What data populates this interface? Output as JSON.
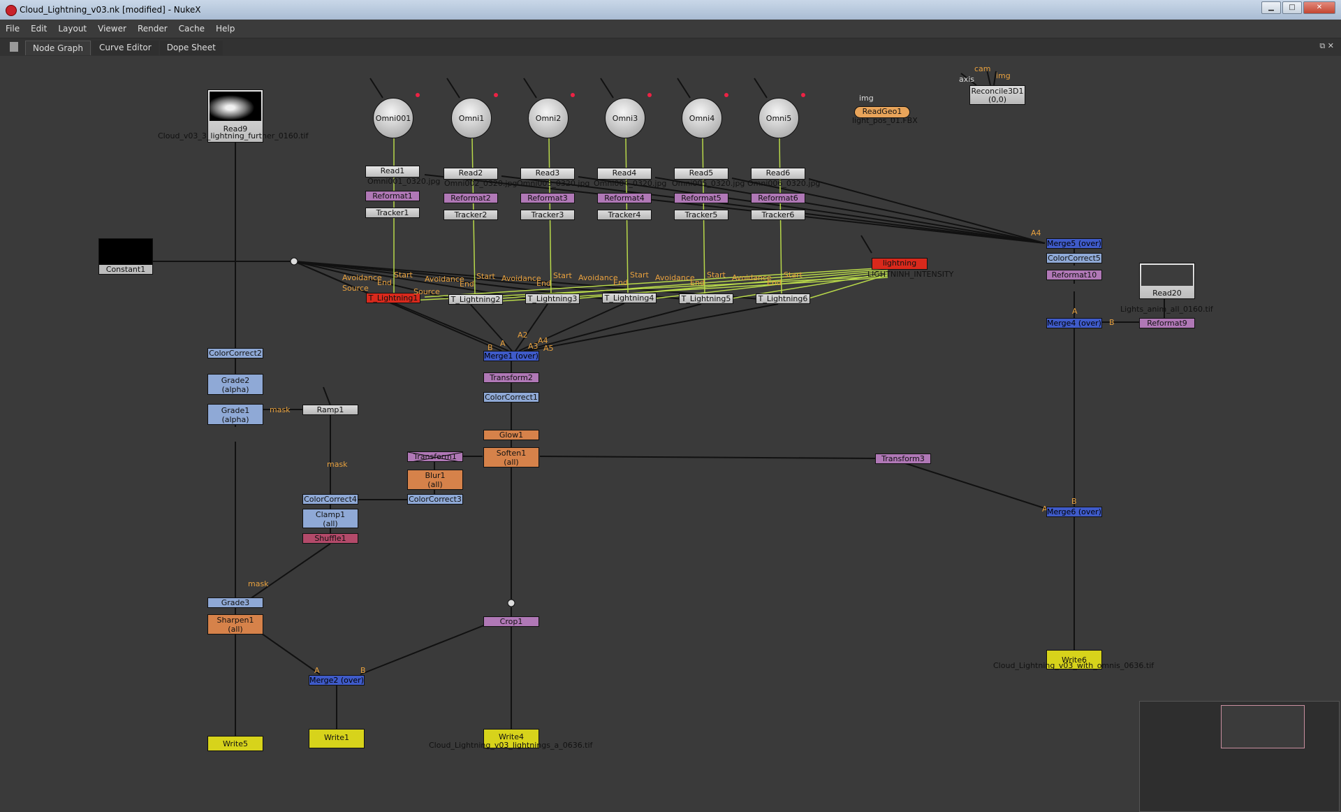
{
  "window": {
    "title": "Cloud_Lightning_v03.nk [modified] - NukeX"
  },
  "menu": [
    "File",
    "Edit",
    "Layout",
    "Viewer",
    "Render",
    "Cache",
    "Help"
  ],
  "tabs": [
    "Node Graph",
    "Curve Editor",
    "Dope Sheet"
  ],
  "colors": {
    "read": "#d0d0d0",
    "reformat": "#b078b6",
    "lightning_red": "#d9291c",
    "merge_blue": "#3f5bc9",
    "color_lblue": "#8fa9d6",
    "filter_orange": "#d6824a",
    "write_yellow": "#d7d31b",
    "wire_green": "#b8d84a",
    "pin_orange": "#e8a13e"
  },
  "nodes": {
    "read9": {
      "name": "Read9",
      "file": "Cloud_v03_3_lightning_further_0160.tif"
    },
    "constant1": {
      "name": "Constant1"
    },
    "omnis": [
      "Omni001",
      "Omni1",
      "Omni2",
      "Omni3",
      "Omni4",
      "Omni5"
    ],
    "reads": [
      {
        "name": "Read1",
        "file": "Omni001_0320.jpg"
      },
      {
        "name": "Read2",
        "file": "Omni002_0320.jpg"
      },
      {
        "name": "Read3",
        "file": "Omni003_0320.jpg"
      },
      {
        "name": "Read4",
        "file": "Omni004_0320.jpg"
      },
      {
        "name": "Read5",
        "file": "Omni005_0320.jpg"
      },
      {
        "name": "Read6",
        "file": "Omni006_0320.jpg"
      }
    ],
    "reformats": [
      "Reformat1",
      "Reformat2",
      "Reformat3",
      "Reformat4",
      "Reformat5",
      "Reformat6"
    ],
    "trackers": [
      "Tracker1",
      "Tracker2",
      "Tracker3",
      "Tracker4",
      "Tracker5",
      "Tracker6"
    ],
    "lightnings": [
      "T_Lightning1",
      "T_Lightning2",
      "T_Lightning3",
      "T_Lightning4",
      "T_Lightning5",
      "T_Lightning6"
    ],
    "readgeo1": {
      "name": "ReadGeo1",
      "file": "light_pos_01.FBX",
      "input": "img"
    },
    "reconcile": {
      "name": "Reconcile3D1",
      "sub": "(0,0)",
      "inputs": [
        "cam",
        "img",
        "axis"
      ]
    },
    "lightning": {
      "name": "lightning",
      "sub": "LIGHTNINH_INTENSITY"
    },
    "merge5": "Merge5 (over)",
    "colorcorrect5": "ColorCorrect5",
    "reformat10": "Reformat10",
    "read20": {
      "name": "Read20",
      "file": "Lights_anim_all_0160.tif"
    },
    "merge4": "Merge4 (over)",
    "reformat9": "Reformat9",
    "colorcorrect2": "ColorCorrect2",
    "grade2": {
      "name": "Grade2",
      "sub": "(alpha)"
    },
    "grade1": {
      "name": "Grade1",
      "sub": "(alpha)"
    },
    "ramp1": "Ramp1",
    "merge1": "Merge1 (over)",
    "transform2": "Transform2",
    "colorcorrect1": "ColorCorrect1",
    "glow1": "Glow1",
    "soften1": {
      "name": "Soften1",
      "sub": "(all)"
    },
    "transform1": "Transform1",
    "blur1": {
      "name": "Blur1",
      "sub": "(all)"
    },
    "colorcorrect3": "ColorCorrect3",
    "colorcorrect4": "ColorCorrect4",
    "clamp1": {
      "name": "Clamp1",
      "sub": "(all)"
    },
    "shuffle1": "Shuffle1",
    "transform3": "Transform3",
    "merge6": "Merge6 (over)",
    "grade3": "Grade3",
    "sharpen1": {
      "name": "Sharpen1",
      "sub": "(all)"
    },
    "merge2": "Merge2 (over)",
    "crop1": "Crop1",
    "write5": "Write5",
    "write1": "Write1",
    "write4": {
      "name": "Write4",
      "file": "Cloud_Lightning_v03_lightnings_a_0636.tif"
    },
    "write6": {
      "name": "Write6",
      "file": "Cloud_Lightning_v03_with_omnis_0636.tif"
    }
  },
  "pins": {
    "mask": "mask",
    "avoidance": "Avoidance",
    "end": "End",
    "start": "Start",
    "source": "Source",
    "a": "A",
    "b": "B",
    "a2": "A2",
    "a3": "A3",
    "a4": "A4",
    "a5": "A5"
  }
}
